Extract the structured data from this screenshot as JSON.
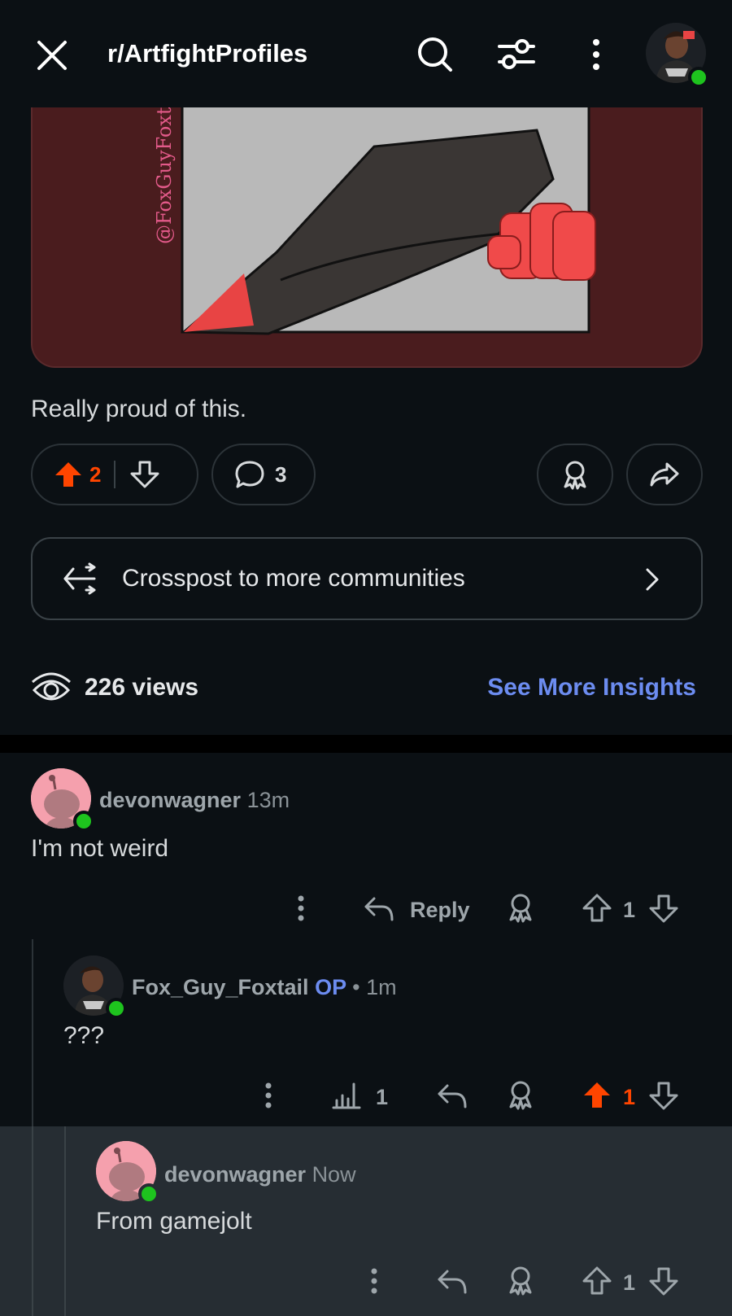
{
  "header": {
    "title": "r/ArtfightProfiles"
  },
  "post": {
    "body": "Really proud of this.",
    "watermark": "@FoxGuyFoxtail",
    "votes": "2",
    "comments": "3",
    "crosspost_label": "Crosspost to more communities",
    "views": "226 views",
    "insights_label": "See More Insights"
  },
  "comments": [
    {
      "user": "devonwagner",
      "time": "13m",
      "text": "I'm not weird",
      "reply_label": "Reply",
      "votes": "1"
    },
    {
      "user": "Fox_Guy_Foxtail",
      "op": "OP",
      "time": "• 1m",
      "text": "???",
      "stats": "1",
      "votes": "1"
    },
    {
      "user": "devonwagner",
      "time": "Now",
      "text": "From gamejolt",
      "votes": "1"
    }
  ],
  "colors": {
    "upvote_active": "#ff4500",
    "link": "#6c8cf0",
    "online": "#1ec31e",
    "avatar_bg": "#f5a0ad"
  }
}
